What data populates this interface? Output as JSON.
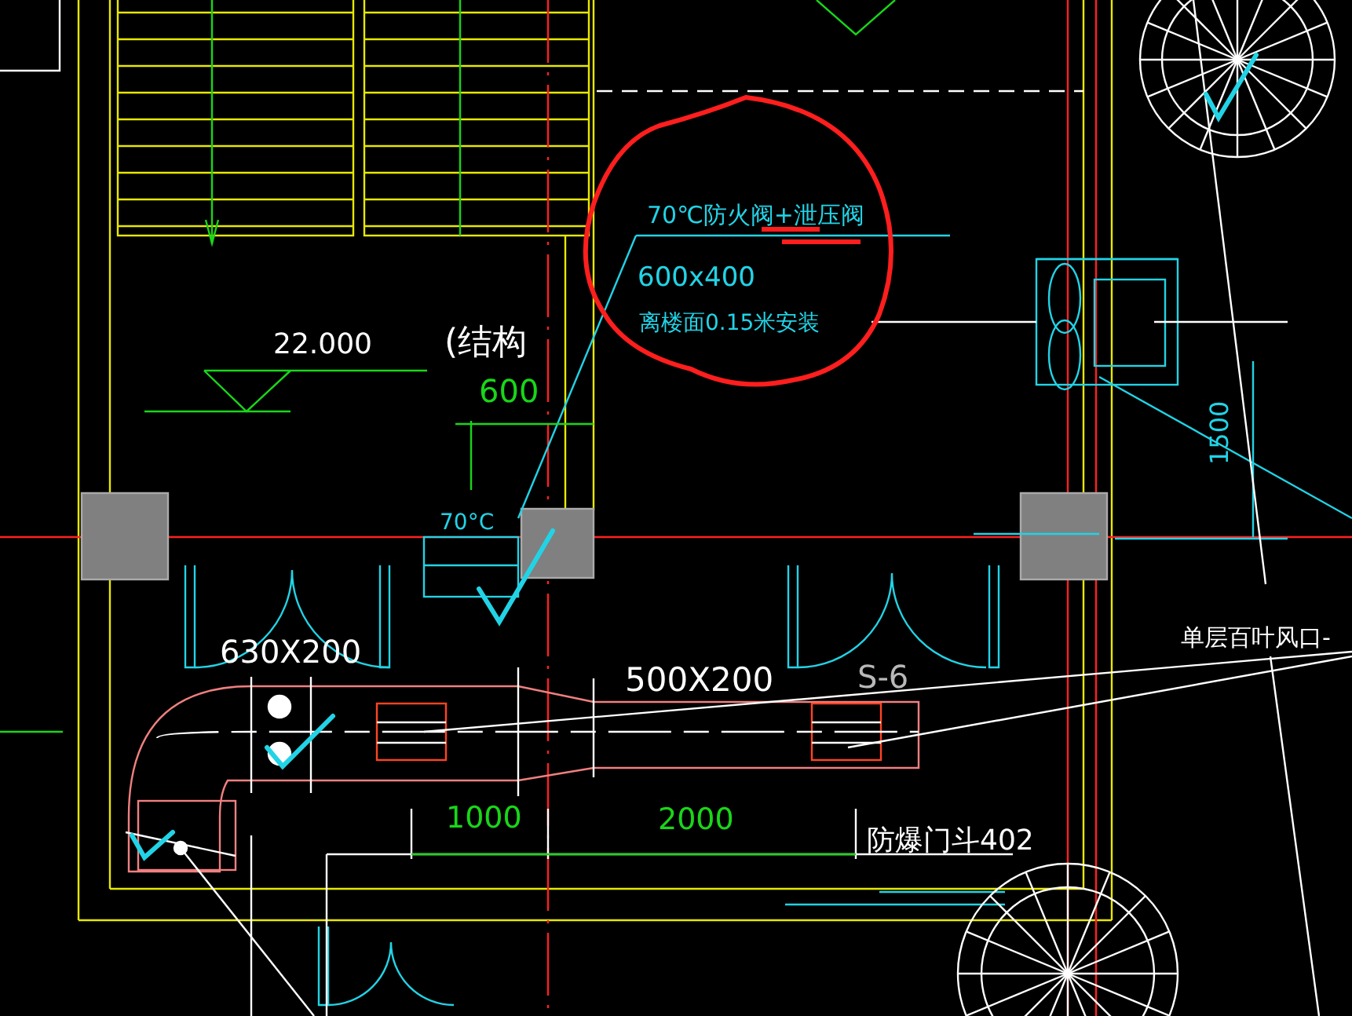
{
  "drawing": {
    "labels": [
      {
        "kind": "note",
        "text": "70℃防火阀+泄压阀"
      },
      {
        "kind": "note",
        "text": "600x400"
      },
      {
        "kind": "note",
        "text": "离楼面0.15米安装"
      },
      {
        "kind": "elevation",
        "text": "22.000"
      },
      {
        "kind": "elevation",
        "text": "(结构"
      },
      {
        "kind": "dimension",
        "text": "600"
      },
      {
        "kind": "note",
        "text": "70°C"
      },
      {
        "kind": "size",
        "text": "630X200"
      },
      {
        "kind": "size",
        "text": "500X200"
      },
      {
        "kind": "tag",
        "text": "S-6"
      },
      {
        "kind": "dimension",
        "text": "1000"
      },
      {
        "kind": "dimension",
        "text": "2000"
      },
      {
        "kind": "size",
        "text": "防爆门斗402"
      },
      {
        "kind": "note",
        "text": "1500"
      },
      {
        "kind": "size",
        "text": "单层百叶风口-"
      }
    ]
  }
}
